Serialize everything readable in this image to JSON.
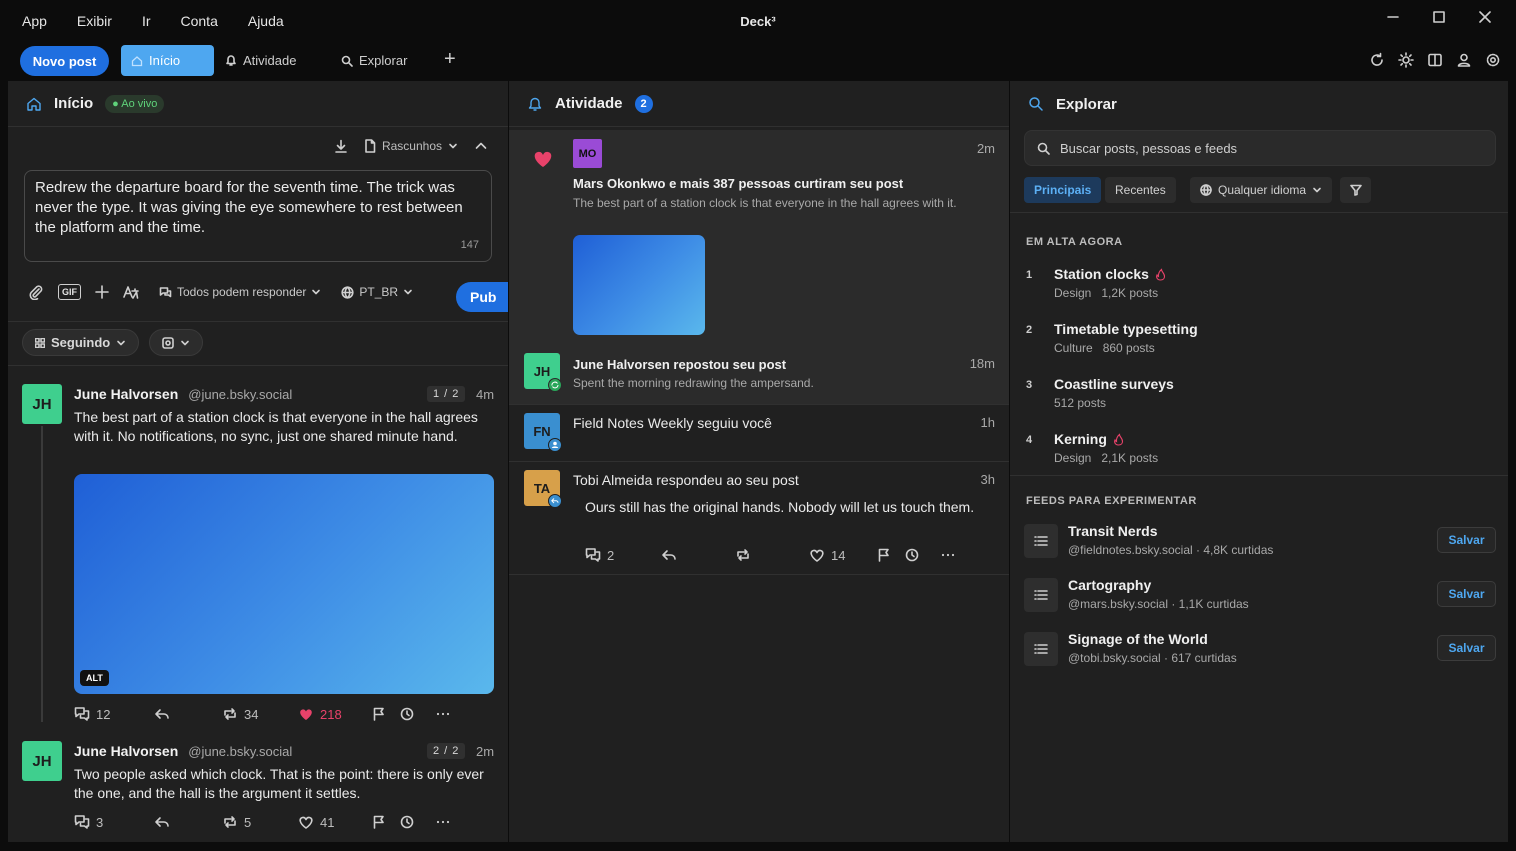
{
  "app": {
    "title": "Deck³",
    "menu": [
      "App",
      "Exibir",
      "Ir",
      "Conta",
      "Ajuda"
    ]
  },
  "toolbar": {
    "new_post": "Novo post",
    "tabs": [
      {
        "label": "Início",
        "icon": "home-icon",
        "active": true
      },
      {
        "label": "Atividade",
        "icon": "bell-icon"
      },
      {
        "label": "Explorar",
        "icon": "search-icon"
      }
    ],
    "add_tab": "+",
    "right_icons": [
      "refresh-icon",
      "sun-icon",
      "columns-icon",
      "user-icon",
      "gear-icon"
    ]
  },
  "home": {
    "title": "Início",
    "live": "● Ao vivo",
    "drafts": "Rascunhos",
    "composer_text": "Redrew the departure board for the seventh time. The trick was never the type. It was giving the eye somewhere to rest between the platform and the time.",
    "char_count": "147",
    "reply_setting": "Todos podem responder",
    "language": "PT_BR",
    "publish": "Pub",
    "gif": "GIF",
    "filter": "Seguindo",
    "posts": [
      {
        "initials": "JH",
        "name": "June Halvorsen",
        "handle": "@june.bsky.social",
        "counter": "1 / 2",
        "time": "4m",
        "text": "The best part of a station clock is that everyone in the hall agrees with it. No notifications, no sync, just one shared minute hand.",
        "alt": "ALT",
        "replies": "12",
        "reposts": "34",
        "likes": "218"
      },
      {
        "initials": "JH",
        "name": "June Halvorsen",
        "handle": "@june.bsky.social",
        "counter": "2 / 2",
        "time": "2m",
        "text": "Two people asked which clock. That is the point: there is only ever the one, and the hall is the argument it settles.",
        "replies": "3",
        "reposts": "5",
        "likes": "41"
      }
    ]
  },
  "activity": {
    "title": "Atividade",
    "badge": "2",
    "items": [
      {
        "initials": "MO",
        "title": "Mars Okonkwo e mais 387 pessoas curtiram seu post",
        "snippet": "The best part of a station clock is that everyone in the hall agrees with it.",
        "time": "2m"
      },
      {
        "initials": "JH",
        "title": "June Halvorsen repostou seu post",
        "snippet": "Spent the morning redrawing the ampersand.",
        "time": "18m"
      },
      {
        "initials": "FN",
        "title": "Field Notes Weekly seguiu você",
        "time": "1h"
      },
      {
        "initials": "TA",
        "title": "Tobi Almeida respondeu ao seu post",
        "text": "Ours still has the original hands. Nobody will let us touch them.",
        "time": "3h",
        "replies": "2",
        "likes": "14"
      }
    ]
  },
  "explore": {
    "title": "Explorar",
    "search_placeholder": "Buscar posts, pessoas e feeds",
    "seg_main": "Principais",
    "seg_recent": "Recentes",
    "language": "Qualquer idioma",
    "trending_title": "EM ALTA AGORA",
    "trends": [
      {
        "rank": "1",
        "name": "Station clocks",
        "hot": true,
        "category": "Design",
        "posts": "1,2K posts"
      },
      {
        "rank": "2",
        "name": "Timetable typesetting",
        "hot": false,
        "category": "Culture",
        "posts": "860 posts"
      },
      {
        "rank": "3",
        "name": "Coastline surveys",
        "hot": false,
        "category": "",
        "posts": "512 posts"
      },
      {
        "rank": "4",
        "name": "Kerning",
        "hot": true,
        "category": "Design",
        "posts": "2,1K posts"
      }
    ],
    "feeds_title": "FEEDS PARA EXPERIMENTAR",
    "feeds": [
      {
        "name": "Transit Nerds",
        "meta": "@fieldnotes.bsky.social  · 4,8K curtidas",
        "save": "Salvar"
      },
      {
        "name": "Cartography",
        "meta": "@mars.bsky.social  · 1,1K curtidas",
        "save": "Salvar"
      },
      {
        "name": "Signage of the World",
        "meta": "@tobi.bsky.social  · 617 curtidas",
        "save": "Salvar"
      }
    ]
  },
  "colors": {
    "accent": "#1f6fe0",
    "active_tab": "#4ea7f0",
    "like": "#e8426a",
    "avatar_jh": "#3fcf8e",
    "avatar_mo": "#9a4bd6",
    "avatar_fn": "#3a8fd0",
    "avatar_ta": "#d7a04a"
  }
}
